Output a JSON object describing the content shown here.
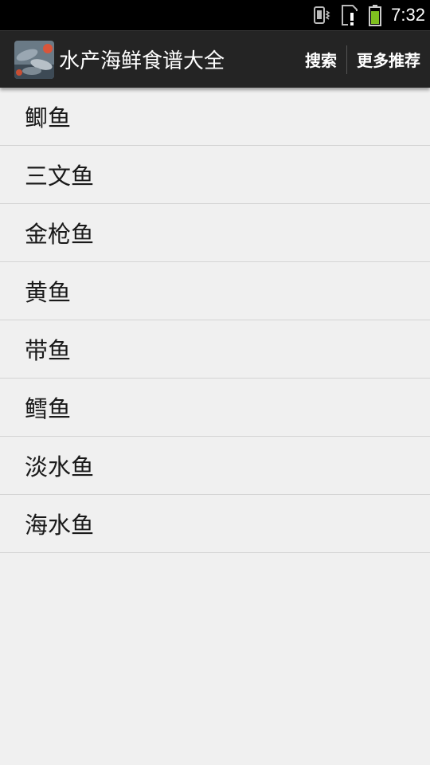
{
  "status_bar": {
    "time": "7:32",
    "icons": [
      "vibrate-icon",
      "sim-alert-icon",
      "battery-icon"
    ],
    "battery_color": "#7fc01f"
  },
  "action_bar": {
    "title": "水产海鲜食谱大全",
    "search_label": "搜索",
    "more_label": "更多推荐"
  },
  "list": {
    "items": [
      {
        "label": "鲫鱼"
      },
      {
        "label": "三文鱼"
      },
      {
        "label": "金枪鱼"
      },
      {
        "label": "黄鱼"
      },
      {
        "label": "带鱼"
      },
      {
        "label": "鳕鱼"
      },
      {
        "label": "淡水鱼"
      },
      {
        "label": "海水鱼"
      }
    ]
  }
}
